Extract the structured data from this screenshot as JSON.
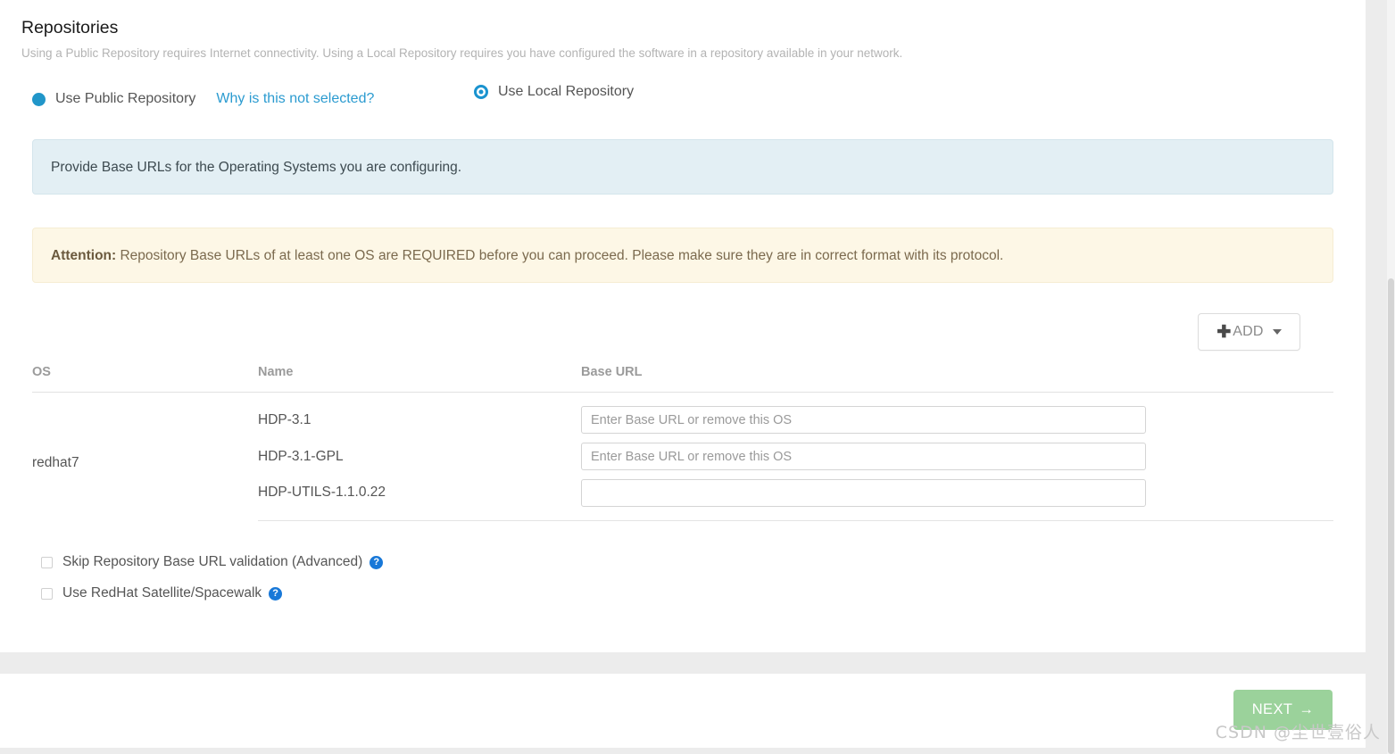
{
  "page": {
    "title": "Repositories",
    "subtitle": "Using a Public Repository requires Internet connectivity. Using a Local Repository requires you have configured the software in a repository available in your network."
  },
  "repo_choice": {
    "public": {
      "label": "Use Public Repository",
      "selected": false,
      "why_link": "Why is this not selected?"
    },
    "local": {
      "label": "Use Local Repository",
      "selected": true
    }
  },
  "alerts": {
    "info": "Provide Base URLs for the Operating Systems you are configuring.",
    "warning": {
      "strong": "Attention:",
      "text": " Repository Base URLs of at least one OS are REQUIRED before you can proceed. Please make sure they are in correct format with its protocol."
    }
  },
  "toolbar": {
    "add_label": "ADD",
    "add_icon": "plus-icon",
    "caret_icon": "chevron-down-icon"
  },
  "table": {
    "headers": {
      "os": "OS",
      "name": "Name",
      "base_url": "Base URL"
    },
    "os_name": "redhat7",
    "rows": [
      {
        "name": "HDP-3.1",
        "url_value": "",
        "url_placeholder": "Enter Base URL or remove this OS"
      },
      {
        "name": "HDP-3.1-GPL",
        "url_value": "",
        "url_placeholder": "Enter Base URL or remove this OS"
      },
      {
        "name": "HDP-UTILS-1.1.0.22",
        "url_value": "",
        "url_placeholder": ""
      }
    ]
  },
  "options": [
    {
      "label": "Skip Repository Base URL validation (Advanced)",
      "checked": false,
      "help_icon": "question-mark-icon"
    },
    {
      "label": "Use RedHat Satellite/Spacewalk",
      "checked": false,
      "help_icon": "question-mark-icon"
    }
  ],
  "footer": {
    "next_label": "NEXT",
    "next_arrow": "→"
  },
  "watermark": "CSDN @尘世壹俗人",
  "colors": {
    "accent_blue": "#2b9bd0",
    "info_bg": "#e3eff4",
    "warning_bg": "#fdf7e6",
    "next_green": "#9bd29b",
    "help_blue": "#1878d8"
  }
}
